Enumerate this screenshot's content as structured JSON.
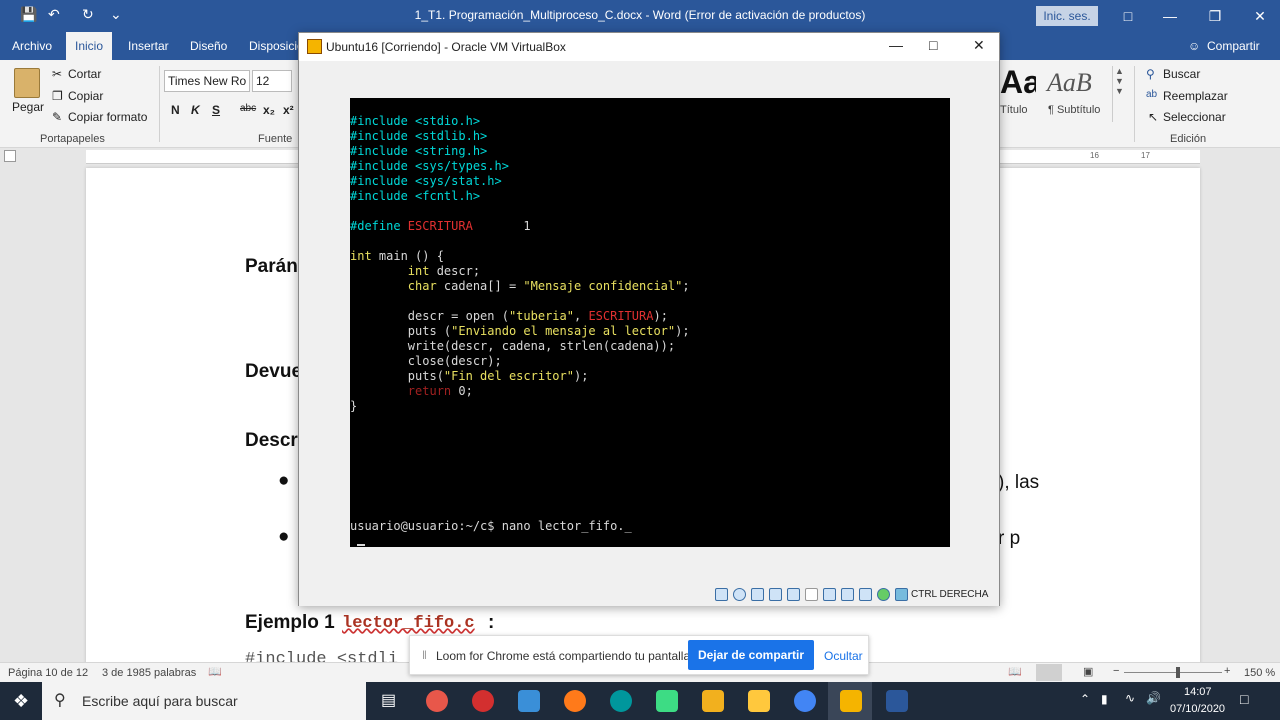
{
  "word": {
    "window_title": "1_T1. Programación_Multiproceso_C.docx  -  Word (Error de activación de productos)",
    "signin_label": "Inic. ses.",
    "tabs": [
      "Archivo",
      "Inicio",
      "Insertar",
      "Diseño",
      "Disposició"
    ],
    "share_label": "Compartir",
    "clipboard": {
      "paste": "Pegar",
      "cut": "Cortar",
      "copy": "Copiar",
      "format_painter": "Copiar formato",
      "group": "Portapapeles"
    },
    "font": {
      "name": "Times New Ro",
      "size": "12",
      "group": "Fuente",
      "bold": "N",
      "italic": "K",
      "underline": "S",
      "strike": "abc",
      "sub": "x₂",
      "sup": "x²"
    },
    "styles": {
      "title_preview": "Aa",
      "title_label": "Título",
      "subtitle_preview": "AaB",
      "subtitle_label": "¶ Subtítulo"
    },
    "editing": {
      "find": "Buscar",
      "replace": "Reemplazar",
      "select": "Seleccionar",
      "group": "Edición"
    },
    "document": {
      "heading_params": "Parán",
      "heading_returns": "Devue",
      "heading_desc": "Descr",
      "bullet1_tail": "), las",
      "bullet2_tail": "r p",
      "example_label": "Ejemplo 1",
      "example_file": "lector_fifo.c",
      "example_colon": ":",
      "code_peek": "#include <stdli"
    },
    "status": {
      "page": "Página 10 de 12",
      "words": "3 de 1985 palabras",
      "zoom": "150 %"
    }
  },
  "vbox": {
    "title": "Ubuntu16 [Corriendo] - Oracle VM VirtualBox",
    "status_label": "CTRL DERECHA",
    "terminal_lines": [
      [
        {
          "t": "#include <stdio.h>",
          "c": "c-cyan"
        }
      ],
      [
        {
          "t": "#include <stdlib.h>",
          "c": "c-cyan"
        }
      ],
      [
        {
          "t": "#include <string.h>",
          "c": "c-cyan"
        }
      ],
      [
        {
          "t": "#include <sys/types.h>",
          "c": "c-cyan"
        }
      ],
      [
        {
          "t": "#include <sys/stat.h>",
          "c": "c-cyan"
        }
      ],
      [
        {
          "t": "#include <fcntl.h>",
          "c": "c-cyan"
        }
      ],
      [],
      [
        {
          "t": "#define ",
          "c": "c-cyan"
        },
        {
          "t": "ESCRITURA",
          "c": "c-red"
        },
        {
          "t": "       1",
          "c": "c-wht"
        }
      ],
      [],
      [
        {
          "t": "int",
          "c": "c-yel"
        },
        {
          "t": " main () {",
          "c": "c-wht"
        }
      ],
      [
        {
          "t": "        ",
          "c": "c-wht"
        },
        {
          "t": "int",
          "c": "c-yel"
        },
        {
          "t": " descr;",
          "c": "c-wht"
        }
      ],
      [
        {
          "t": "        ",
          "c": "c-wht"
        },
        {
          "t": "char",
          "c": "c-yel"
        },
        {
          "t": " cadena[] = ",
          "c": "c-wht"
        },
        {
          "t": "\"Mensaje confidencial\"",
          "c": "c-yel"
        },
        {
          "t": ";",
          "c": "c-wht"
        }
      ],
      [],
      [
        {
          "t": "        descr = open (",
          "c": "c-wht"
        },
        {
          "t": "\"tuberia\"",
          "c": "c-yel"
        },
        {
          "t": ", ",
          "c": "c-wht"
        },
        {
          "t": "ESCRITURA",
          "c": "c-red"
        },
        {
          "t": ");",
          "c": "c-wht"
        }
      ],
      [
        {
          "t": "        puts (",
          "c": "c-wht"
        },
        {
          "t": "\"Enviando el mensaje al lector\"",
          "c": "c-yel"
        },
        {
          "t": ");",
          "c": "c-wht"
        }
      ],
      [
        {
          "t": "        write(descr, cadena, strlen(cadena));",
          "c": "c-wht"
        }
      ],
      [
        {
          "t": "        close(descr);",
          "c": "c-wht"
        }
      ],
      [
        {
          "t": "        puts(",
          "c": "c-wht"
        },
        {
          "t": "\"Fin del escritor\"",
          "c": "c-yel"
        },
        {
          "t": ");",
          "c": "c-wht"
        }
      ],
      [
        {
          "t": "        ",
          "c": "c-wht"
        },
        {
          "t": "return",
          "c": "c-dred"
        },
        {
          "t": " 0;",
          "c": "c-wht"
        }
      ],
      [
        {
          "t": "}",
          "c": "c-wht"
        }
      ]
    ],
    "prompt_line": "usuario@usuario:~/c$ nano lector_fifo._"
  },
  "loom": {
    "message": "Loom for Chrome está compartiendo tu pantalla.",
    "stop_label": "Dejar de compartir",
    "hide_label": "Ocultar"
  },
  "taskbar": {
    "search_placeholder": "Escribe aquí para buscar",
    "time": "14:07",
    "date": "07/10/2020"
  },
  "colors": {
    "word_blue": "#2b579a",
    "loom_blue": "#1a73e8",
    "terminal_bg": "#000000",
    "taskbar_bg": "#1e2a3a"
  }
}
